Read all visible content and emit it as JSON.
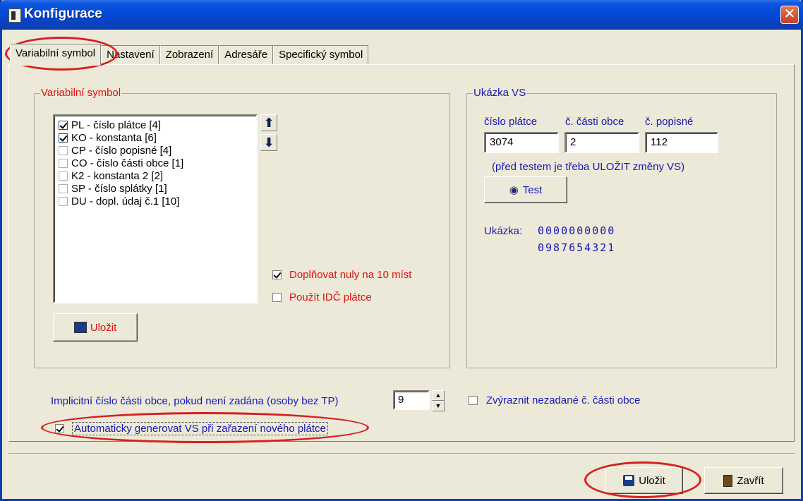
{
  "window": {
    "title": "Konfigurace",
    "close_symbol": "✕"
  },
  "tabs": [
    {
      "label": "Variabilní symbol"
    },
    {
      "label": "Nastavení"
    },
    {
      "label": "Zobrazení"
    },
    {
      "label": "Adresáře"
    },
    {
      "label": "Specifický symbol"
    }
  ],
  "vs_group": {
    "label": "Variabilní symbol",
    "items": [
      {
        "label": "PL - číslo plátce [4]",
        "checked": true
      },
      {
        "label": "KO - konstanta [6]",
        "checked": true
      },
      {
        "label": "CP - číslo popisné [4]",
        "checked": false
      },
      {
        "label": "CO - číslo části obce [1]",
        "checked": false
      },
      {
        "label": "K2 - konstanta 2 [2]",
        "checked": false
      },
      {
        "label": "SP - číslo splátky [1]",
        "checked": false
      },
      {
        "label": "DU - dopl. údaj č.1 [10]",
        "checked": false
      }
    ],
    "up_symbol": "⬆",
    "down_symbol": "⬇",
    "pad_zeros_label": "Doplňovat nuly na 10 míst",
    "pad_zeros_checked": true,
    "use_idc_label": "Použít IDČ plátce",
    "use_idc_checked": false,
    "save_label": "Uložit"
  },
  "sample_group": {
    "label": "Ukázka VS",
    "col1_label": "číslo plátce",
    "col2_label": "č. části obce",
    "col3_label": "č. popisné",
    "col1_value": "3074",
    "col2_value": "2",
    "col3_value": "112",
    "note": "(před testem je třeba ULOŽIT změny VS)",
    "test_label": "Test",
    "sample_label": "Ukázka:",
    "sample_line1": "0000000000",
    "sample_line2": "0987654321"
  },
  "bottom": {
    "implicit_label": "Implicitní číslo části obce, pokud není zadána (osoby bez TP)",
    "implicit_value": "9",
    "highlight_label": "Zvýraznit nezadané č. části obce",
    "highlight_checked": false,
    "auto_generate_label": "Automaticky generovat VS při zařazení nového plátce",
    "auto_generate_checked": true
  },
  "footer": {
    "save_label": "Uložit",
    "close_label": "Zavřít"
  },
  "colors": {
    "title_blue": "#0548d6",
    "annotation_red": "#d62020",
    "label_red": "#e01010",
    "label_blue": "#1818b8"
  }
}
